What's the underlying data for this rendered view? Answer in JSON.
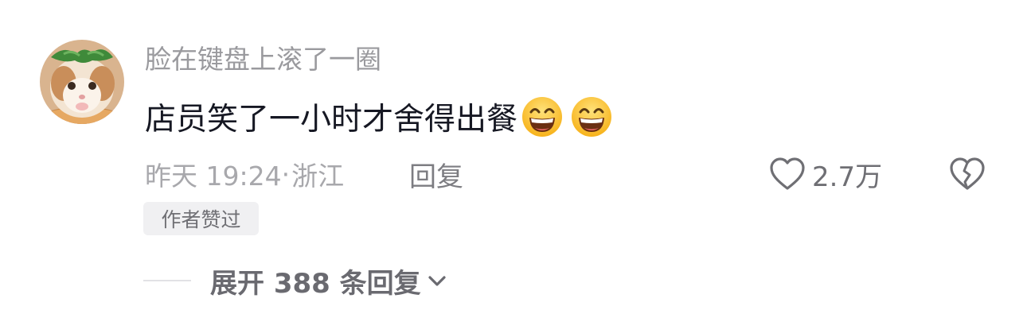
{
  "comment": {
    "username": "脸在键盘上滚了一圈",
    "text": "店员笑了一小时才舍得出餐",
    "emojis": [
      "grinning-face-emoji",
      "grinning-face-emoji"
    ],
    "time": "昨天 19:24",
    "separator": "·",
    "location": "浙江",
    "reply_label": "回复",
    "like_count": "2.7万",
    "author_badge": "作者赞过",
    "expand_label": "展开 388 条回复",
    "icons": {
      "like": "heart-outline-icon",
      "dislike": "broken-heart-icon",
      "expand": "chevron-down-icon"
    },
    "colors": {
      "username": "#9a9a9e",
      "text": "#161823",
      "meta": "#a8a8ac",
      "badge_bg": "#f0f0f2"
    }
  }
}
